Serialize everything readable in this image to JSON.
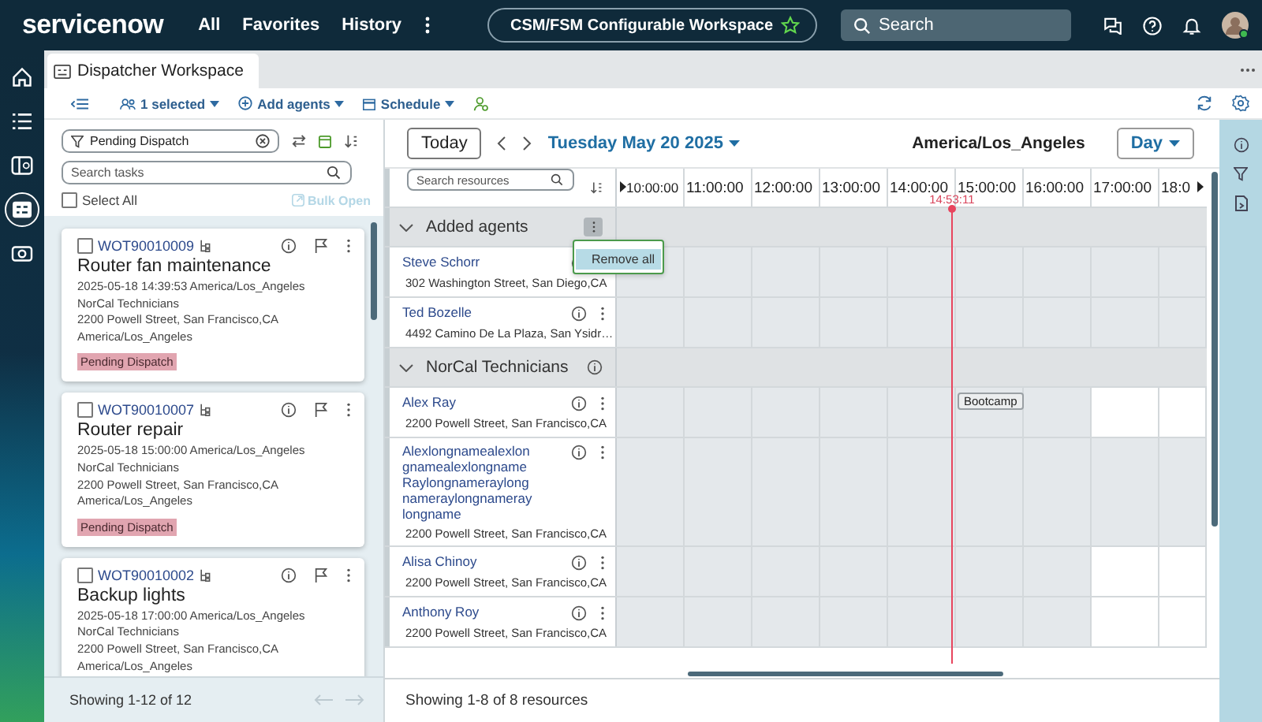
{
  "nav": {
    "logo": "servicenow",
    "links": [
      "All",
      "Favorites",
      "History"
    ],
    "workspace": "CSM/FSM Configurable Workspace",
    "search": {
      "placeholder": "Search"
    }
  },
  "rail": {
    "items": [
      {
        "kind": "home",
        "selected": false
      },
      {
        "kind": "list",
        "selected": false
      },
      {
        "kind": "panel",
        "selected": false
      },
      {
        "kind": "dispatch",
        "selected": true
      },
      {
        "kind": "camera",
        "selected": false
      }
    ]
  },
  "tab": {
    "title": "Dispatcher Workspace"
  },
  "toolbar": {
    "selection": "1 selected",
    "add_agents": "Add agents",
    "schedule": "Schedule"
  },
  "tasks": {
    "filter": "Pending Dispatch",
    "search": {
      "placeholder": "Search tasks"
    },
    "select_all": {
      "label": "Select All",
      "checked": false
    },
    "bulk_open": {
      "label": "Bulk Open",
      "disabled": true
    },
    "cards": [
      {
        "number": "WOT90010009",
        "checked": false,
        "title": "Router fan maintenance",
        "datetime": "2025-05-18 14:39:53 America/Los_Angeles",
        "group": "NorCal Technicians",
        "address": "2200 Powell Street, San Francisco,CA",
        "timezone": "America/Los_Angeles",
        "status": "Pending Dispatch"
      },
      {
        "number": "WOT90010007",
        "checked": false,
        "title": "Router repair",
        "datetime": "2025-05-18 15:00:00 America/Los_Angeles",
        "group": "NorCal Technicians",
        "address": "2200 Powell Street, San Francisco,CA",
        "timezone": "America/Los_Angeles",
        "status": "Pending Dispatch"
      },
      {
        "number": "WOT90010002",
        "checked": false,
        "title": "Backup lights",
        "datetime": "2025-05-18 17:00:00 America/Los_Angeles",
        "group": "NorCal Technicians",
        "address": "2200 Powell Street, San Francisco,CA",
        "timezone": "America/Los_Angeles"
      }
    ],
    "footer": "Showing 1-12 of 12"
  },
  "schedule": {
    "today": "Today",
    "date": "Tuesday May 20 2025",
    "timezone": "America/Los_Angeles",
    "view": "Day",
    "search": {
      "placeholder": "Search resources"
    },
    "hours": [
      "10:00:00",
      "11:00:00",
      "12:00:00",
      "13:00:00",
      "14:00:00",
      "15:00:00",
      "16:00:00",
      "17:00:00",
      "18:0"
    ],
    "now": "14:53:11",
    "groups": [
      {
        "name": "Added agents",
        "info": false,
        "menu_open": true,
        "menu": [
          "Remove all"
        ],
        "resources": [
          {
            "name": "Steve Schorr",
            "address": "302 Washington Street, San Diego,CA",
            "cells": [
              {
                "unavailable": true
              },
              {
                "unavailable": true
              },
              {
                "unavailable": true
              },
              {
                "unavailable": true
              },
              {
                "unavailable": true
              },
              {
                "unavailable": true
              },
              {
                "unavailable": true
              },
              {
                "unavailable": true
              },
              {
                "unavailable": true
              }
            ]
          },
          {
            "name": "Ted Bozelle",
            "address": "4492 Camino De La Plaza, San Ysidr…",
            "cells": [
              {
                "unavailable": true
              },
              {
                "unavailable": true
              },
              {
                "unavailable": true
              },
              {
                "unavailable": true
              },
              {
                "unavailable": true
              },
              {
                "unavailable": true
              },
              {
                "unavailable": true
              },
              {
                "unavailable": true
              },
              {
                "unavailable": true
              }
            ]
          }
        ]
      },
      {
        "name": "NorCal Technicians",
        "info": true,
        "menu_open": false,
        "resources": [
          {
            "name": "Alex Ray",
            "address": "2200 Powell Street, San Francisco,CA",
            "cells": [
              {
                "unavailable": true
              },
              {
                "unavailable": true
              },
              {
                "unavailable": true
              },
              {
                "unavailable": true
              },
              {
                "unavailable": true
              },
              {
                "unavailable": true,
                "event": "Bootcamp"
              },
              {
                "unavailable": true
              },
              {
                "unavailable": false
              },
              {
                "unavailable": false
              }
            ]
          },
          {
            "name": "Alexlongnamealexlongnamealexlongname Raylongnameraylongnameraylongnameraylongname",
            "address": "2200 Powell Street, San Francisco,CA",
            "cells": [
              {
                "unavailable": true
              },
              {
                "unavailable": true
              },
              {
                "unavailable": true
              },
              {
                "unavailable": true
              },
              {
                "unavailable": true
              },
              {
                "unavailable": true
              },
              {
                "unavailable": true
              },
              {
                "unavailable": true
              },
              {
                "unavailable": true
              }
            ]
          },
          {
            "name": "Alisa Chinoy",
            "address": "2200 Powell Street, San Francisco,CA",
            "cells": [
              {
                "unavailable": true
              },
              {
                "unavailable": true
              },
              {
                "unavailable": true
              },
              {
                "unavailable": true
              },
              {
                "unavailable": true
              },
              {
                "unavailable": true
              },
              {
                "unavailable": true
              },
              {
                "unavailable": false
              },
              {
                "unavailable": false
              }
            ]
          },
          {
            "name": "Anthony Roy",
            "address": "2200 Powell Street, San Francisco,CA",
            "cells": [
              {
                "unavailable": true
              },
              {
                "unavailable": true
              },
              {
                "unavailable": true
              },
              {
                "unavailable": true
              },
              {
                "unavailable": true
              },
              {
                "unavailable": true
              },
              {
                "unavailable": true
              },
              {
                "unavailable": false
              },
              {
                "unavailable": false
              }
            ]
          }
        ]
      }
    ],
    "footer": "Showing 1-8 of 8 resources"
  }
}
